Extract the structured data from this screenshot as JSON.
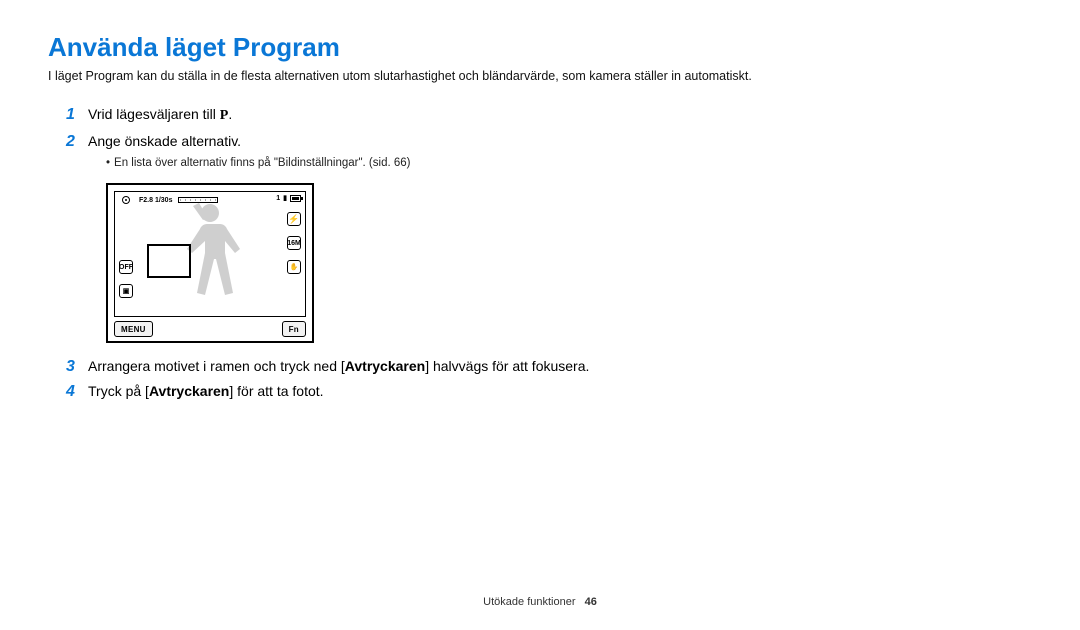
{
  "title": "Använda läget Program",
  "intro": "I läget Program kan du ställa in de flesta alternativen utom slutarhastighet och bländarvärde, som kamera ställer in automatiskt.",
  "steps": {
    "s1_pre": "Vrid lägesväljaren till ",
    "s1_icon": "P",
    "s1_post": ".",
    "s2": "Ange önskade alternativ.",
    "s2_sub": "En lista över alternativ finns på \"Bildinställningar\". (sid. 66)",
    "s3_a": "Arrangera motivet i ramen och tryck ned [",
    "s3_b": "Avtryckaren",
    "s3_c": "] halvvägs för att fokusera.",
    "s4_a": "Tryck på [",
    "s4_b": "Avtryckaren",
    "s4_c": "] för att ta fotot."
  },
  "nums": {
    "n1": "1",
    "n2": "2",
    "n3": "3",
    "n4": "4"
  },
  "screen": {
    "aperture_shutter": "F2.8 1/30s",
    "shots": "1",
    "off": "OFF",
    "res": "16M",
    "menu": "MENU",
    "fn": "Fn"
  },
  "footer": {
    "section": "Utökade funktioner",
    "page": "46"
  }
}
